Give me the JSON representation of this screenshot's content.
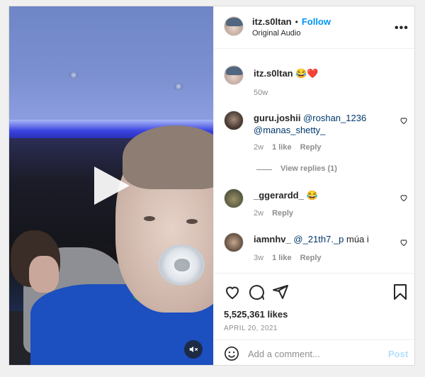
{
  "post": {
    "username": "itz.s0ltan",
    "follow_label": "Follow",
    "audio_label": "Original Audio",
    "more_label": "•••",
    "caption_username": "itz.s0ltan",
    "caption_text": "😂❤️",
    "caption_age": "50w"
  },
  "comments": [
    {
      "username": "guru.joshii",
      "mention1": "@roshan_1236",
      "mention2": "@manas_shetty_",
      "age": "2w",
      "likes": "1 like",
      "reply": "Reply",
      "view_replies": "View replies (1)"
    },
    {
      "username": "_ggerardd_",
      "text": "😂",
      "age": "2w",
      "reply": "Reply"
    },
    {
      "username": "iamnhv_",
      "mention": "@_21th7._p",
      "text": "múa i",
      "age": "3w",
      "likes": "1 like",
      "reply": "Reply"
    }
  ],
  "stats": {
    "likes": "5,525,361 likes",
    "date": "APRIL 20, 2021"
  },
  "composer": {
    "placeholder": "Add a comment...",
    "post_label": "Post"
  },
  "colors": {
    "accent": "#0095f6",
    "post_disabled": "#b2dffc",
    "muted_text": "#8e8e8e"
  }
}
